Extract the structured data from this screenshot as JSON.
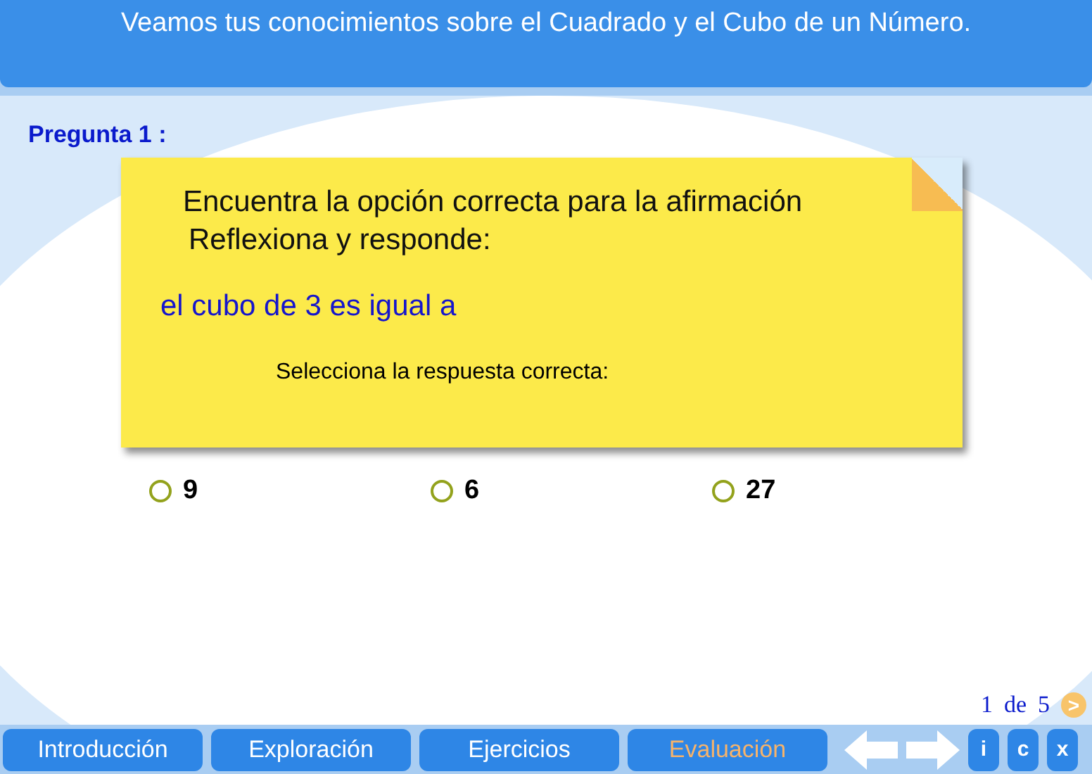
{
  "header": {
    "title": "Veamos tus conocimientos sobre el Cuadrado y el Cubo de un Número."
  },
  "question": {
    "label": "Pregunta 1 :",
    "instruction_1": "Encuentra la opción correcta para la afirmación",
    "instruction_2": "Reflexiona y responde:",
    "statement": "el cubo de 3 es igual a",
    "prompt": "Selecciona la respuesta correcta:"
  },
  "options": [
    {
      "label": "9",
      "selected": false
    },
    {
      "label": "6",
      "selected": false
    },
    {
      "label": "27",
      "selected": false
    }
  ],
  "pager": {
    "current": "1",
    "separator": "de",
    "total": "5",
    "next": ">"
  },
  "tabs": [
    {
      "label": "Introducción",
      "selected": false
    },
    {
      "label": "Exploración",
      "selected": false
    },
    {
      "label": "Ejercicios",
      "selected": false
    },
    {
      "label": "Evaluación",
      "selected": true
    }
  ],
  "buttons": [
    "i",
    "c",
    "x"
  ]
}
